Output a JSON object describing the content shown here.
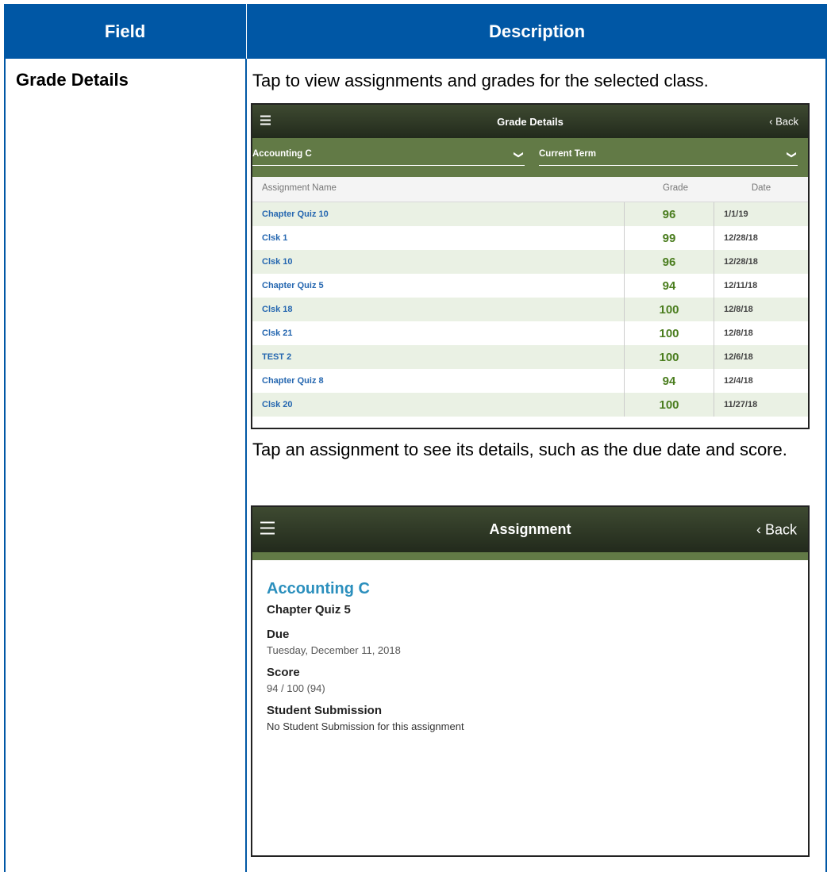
{
  "header": {
    "field": "Field",
    "description": "Description"
  },
  "row": {
    "field_name": "Grade Details",
    "intro": "Tap to view assignments and grades for the selected class.",
    "tap_hint": "Tap an assignment to see its details, such as the due date and score."
  },
  "grades_screen": {
    "title": "Grade Details",
    "back": "‹ Back",
    "class_filter": "Accounting C",
    "term_filter": "Current Term",
    "columns": {
      "name": "Assignment Name",
      "grade": "Grade",
      "date": "Date"
    },
    "rows": [
      {
        "name": "Chapter Quiz 10",
        "grade": "96",
        "date": "1/1/19"
      },
      {
        "name": "Clsk 1",
        "grade": "99",
        "date": "12/28/18"
      },
      {
        "name": "Clsk 10",
        "grade": "96",
        "date": "12/28/18"
      },
      {
        "name": "Chapter Quiz 5",
        "grade": "94",
        "date": "12/11/18"
      },
      {
        "name": "Clsk 18",
        "grade": "100",
        "date": "12/8/18"
      },
      {
        "name": "Clsk 21",
        "grade": "100",
        "date": "12/8/18"
      },
      {
        "name": "TEST 2",
        "grade": "100",
        "date": "12/6/18"
      },
      {
        "name": "Chapter Quiz 8",
        "grade": "94",
        "date": "12/4/18"
      },
      {
        "name": "Clsk 20",
        "grade": "100",
        "date": "11/27/18"
      }
    ]
  },
  "assignment_screen": {
    "title": "Assignment",
    "back": "‹ Back",
    "course": "Accounting C",
    "assignment": "Chapter Quiz 5",
    "due_label": "Due",
    "due_value": "Tuesday, December 11, 2018",
    "score_label": "Score",
    "score_value": "94 / 100 (94)",
    "submission_label": "Student Submission",
    "submission_value": "No Student Submission for this assignment"
  },
  "colors": {
    "header_blue": "#0057a5",
    "app_green": "#627a46",
    "grade_green": "#4a7d1e",
    "link_blue": "#2567b0"
  },
  "icons": {
    "menu": "hamburger-icon",
    "dropdown": "chevron-down-icon"
  }
}
